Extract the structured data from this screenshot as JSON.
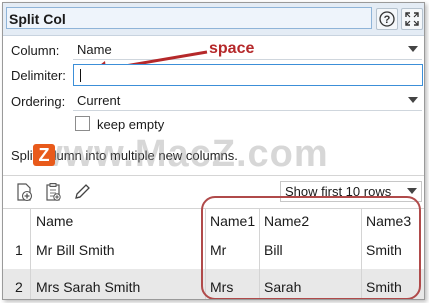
{
  "window": {
    "title": "Split Col",
    "help_icon": "help-icon",
    "expand_icon": "expand-icon"
  },
  "form": {
    "column_label": "Column:",
    "column_value": "Name",
    "delimiter_label": "Delimiter:",
    "delimiter_value": "",
    "ordering_label": "Ordering:",
    "ordering_value": "Current",
    "keep_empty_label": "keep empty",
    "keep_empty_checked": false
  },
  "annotation": {
    "text": "space",
    "color": "#b5282a"
  },
  "description": "Split column into multiple new columns.",
  "watermark": "www.MacZ.com",
  "toolbar": {
    "icons": [
      "add-column-icon",
      "paste-icon",
      "edit-icon"
    ],
    "show_rows_value": "Show first 10 rows"
  },
  "grid": {
    "headers": [
      "",
      "Name",
      "Name1",
      "Name2",
      "Name3"
    ],
    "rows": [
      [
        "1",
        "Mr Bill Smith",
        "Mr",
        "Bill",
        "Smith"
      ],
      [
        "2",
        "Mrs Sarah Smith",
        "Mrs",
        "Sarah",
        "Smith"
      ]
    ]
  },
  "colors": {
    "accent": "#3c8fd8",
    "annotation": "#b5282a",
    "highlight": "#b04a4a"
  }
}
